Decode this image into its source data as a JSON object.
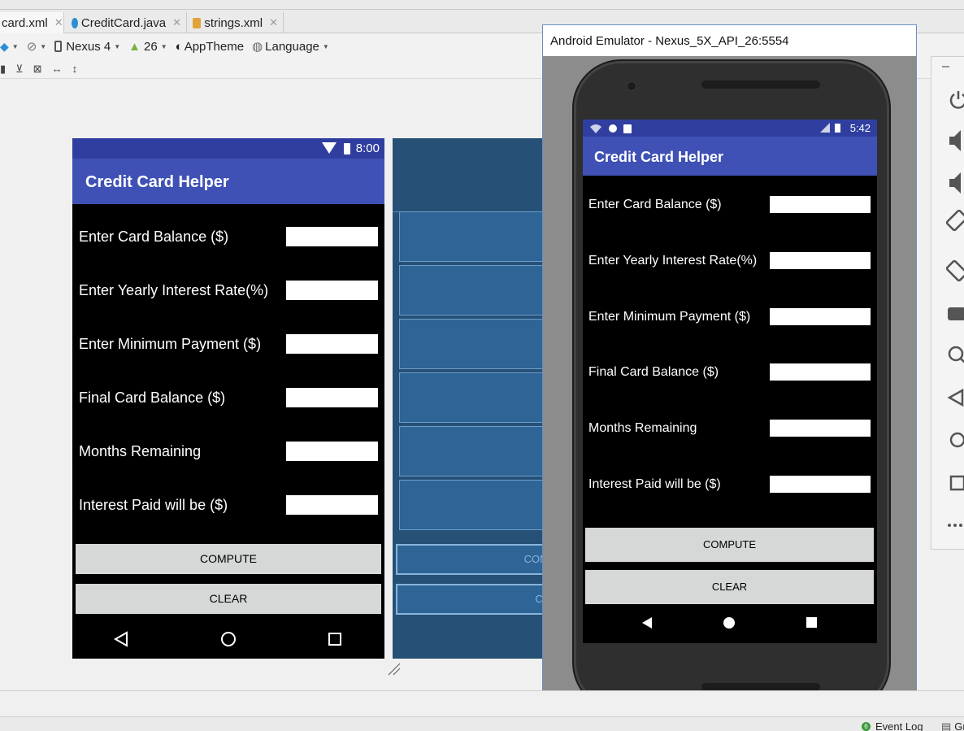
{
  "tabs": [
    {
      "label": "card.xml",
      "active": true,
      "icon": "xml-file-icon"
    },
    {
      "label": "CreditCard.java",
      "active": false,
      "icon": "java-class-icon"
    },
    {
      "label": "strings.xml",
      "active": false,
      "icon": "xml-file-icon"
    }
  ],
  "toolbar": {
    "device": "Nexus 4",
    "api": "26",
    "theme": "AppTheme",
    "language": "Language"
  },
  "preview": {
    "time": "8:00",
    "app_title": "Credit Card Helper",
    "fields": [
      "Enter Card Balance ($)",
      "Enter Yearly Interest Rate(%)",
      "Enter Minimum Payment ($)",
      "Final Card Balance ($)",
      "Months Remaining",
      "Interest Paid will be ($)"
    ],
    "compute_label": "COMPUTE",
    "clear_label": "CLEAR"
  },
  "blueprint": {
    "compute_fragment": "COM",
    "clear_fragment": "CL"
  },
  "emulator": {
    "window_title": "Android Emulator - Nexus_5X_API_26:5554",
    "time": "5:42",
    "app_title": "Credit Card Helper",
    "fields": [
      "Enter Card Balance ($)",
      "Enter Yearly Interest Rate(%)",
      "Enter Minimum Payment ($)",
      "Final Card Balance ($)",
      "Months Remaining",
      "Interest Paid will be ($)"
    ],
    "compute_label": "COMPUTE",
    "clear_label": "CLEAR"
  },
  "statusbar": {
    "event_log_count": "6",
    "event_log_label": "Event Log",
    "gradle_label": "Gr"
  },
  "colors": {
    "primary": "#3f51b5",
    "primary_dark": "#303f9f",
    "button_gray": "#d6d7d7",
    "blueprint_bg": "#265076"
  }
}
